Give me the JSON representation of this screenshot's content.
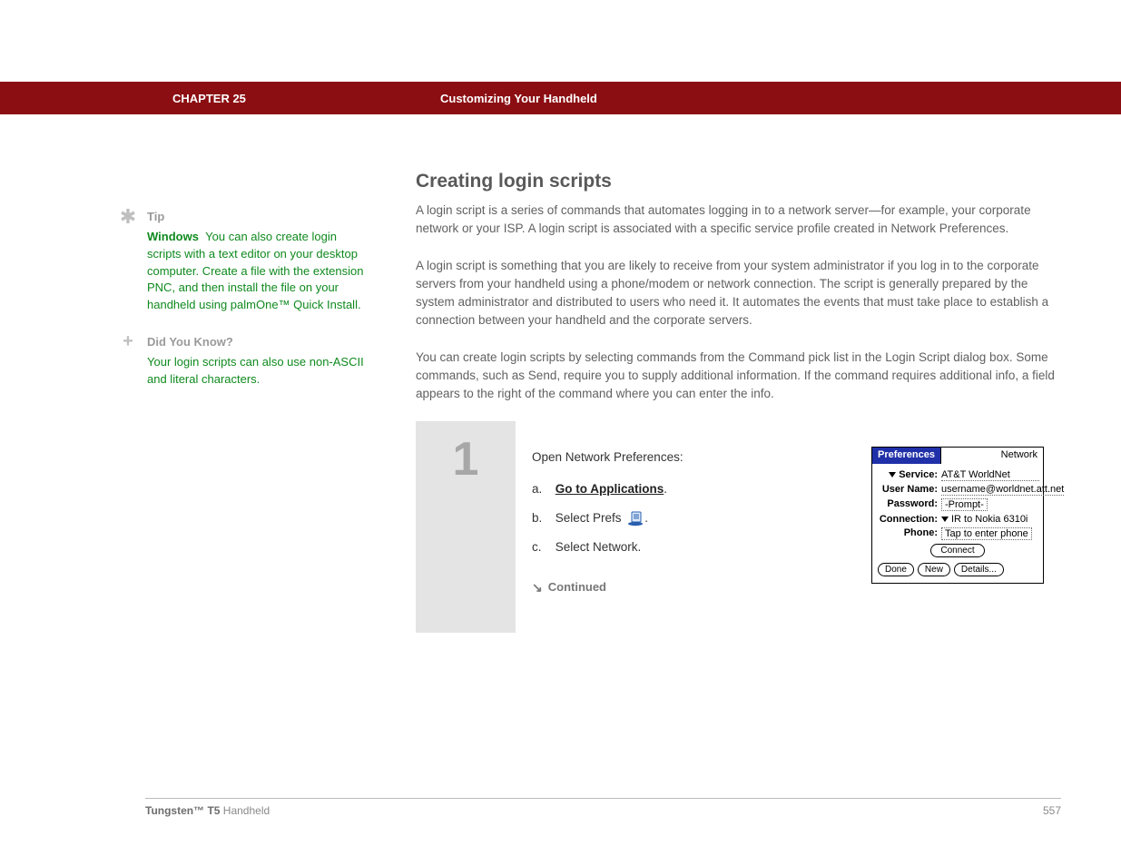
{
  "header": {
    "chapter": "CHAPTER 25",
    "title": "Customizing Your Handheld"
  },
  "sidebar": {
    "tip": {
      "heading": "Tip",
      "lead": "Windows",
      "body": "You can also create login scripts with a text editor on your desktop computer. Create a file with the extension PNC, and then install the file on your handheld using palmOne™ Quick Install."
    },
    "dyk": {
      "heading": "Did You Know?",
      "body": "Your login scripts can also use non-ASCII and literal characters."
    }
  },
  "main": {
    "heading": "Creating login scripts",
    "p1": "A login script is a series of commands that automates logging in to a network server—for example, your corporate network or your ISP. A login script is associated with a specific service profile created in Network Preferences.",
    "p2": "A login script is something that you are likely to receive from your system administrator if you log in to the corporate servers from your handheld using a phone/modem or network connection. The script is generally prepared by the system administrator and distributed to users who need it. It automates the events that must take place to establish a connection between your handheld and the corporate servers.",
    "p3": "You can create login scripts by selecting commands from the Command pick list in the Login Script dialog box. Some commands, such as Send, require you to supply additional information. If the command requires additional info, a field appears to the right of the command where you can enter the info."
  },
  "step": {
    "number": "1",
    "intro": "Open Network Preferences:",
    "a_letter": "a.",
    "a_link": "Go to Applications",
    "a_after": ".",
    "b_letter": "b.",
    "b_text_before": "Select Prefs ",
    "b_after": ".",
    "c_letter": "c.",
    "c_text": "Select Network.",
    "continued": "Continued"
  },
  "palm": {
    "titleLeft": "Preferences",
    "titleRight": "Network",
    "serviceLabel": "Service:",
    "serviceValue": "AT&T WorldNet",
    "userLabel": "User Name:",
    "userValue": "username@worldnet.att.net",
    "passLabel": "Password:",
    "passValue": "-Prompt-",
    "connLabel": "Connection:",
    "connValue": "IR to Nokia 6310i",
    "phoneLabel": "Phone:",
    "phoneValue": "Tap to enter phone",
    "connect": "Connect",
    "done": "Done",
    "new_": "New",
    "details": "Details..."
  },
  "footer": {
    "productBold": "Tungsten™ T5",
    "productRest": " Handheld",
    "page": "557"
  }
}
